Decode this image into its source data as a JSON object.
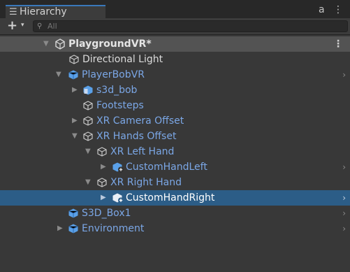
{
  "window": {
    "tab_icon": "hierarchy-list-icon",
    "tab_glyph": "☰",
    "tab_title": "Hierarchy",
    "lock_glyph": "a",
    "menu_glyph": "⋮"
  },
  "toolbar": {
    "add_label": "+",
    "add_caret": "▾",
    "search_placeholder": "All",
    "search_glyph": "⚲"
  },
  "tree": {
    "scene": {
      "label": "PlaygroundVR*",
      "menu": "⋮"
    },
    "rows": [
      {
        "label": "Directional Light",
        "icon": "gameobject-icon",
        "style": "white",
        "expanded": null
      },
      {
        "label": "PlayerBobVR",
        "icon": "prefab-icon",
        "style": "blue",
        "expanded": true,
        "chevron": "›"
      },
      {
        "label": "s3d_bob",
        "icon": "model-prefab-icon",
        "style": "blue",
        "expanded": false
      },
      {
        "label": "Footsteps",
        "icon": "gameobject-icon",
        "style": "blue",
        "expanded": null
      },
      {
        "label": "XR Camera Offset",
        "icon": "gameobject-icon",
        "style": "blue",
        "expanded": false
      },
      {
        "label": "XR Hands Offset",
        "icon": "gameobject-icon",
        "style": "blue",
        "expanded": true
      },
      {
        "label": "XR Left Hand",
        "icon": "gameobject-icon",
        "style": "blue",
        "expanded": true
      },
      {
        "label": "CustomHandLeft",
        "icon": "added-prefab-icon",
        "style": "blue",
        "expanded": false,
        "chevron": "›"
      },
      {
        "label": "XR Right Hand",
        "icon": "gameobject-icon",
        "style": "blue",
        "expanded": true
      },
      {
        "label": "CustomHandRight",
        "icon": "added-prefab-icon",
        "style": "sel",
        "expanded": false,
        "chevron": "›",
        "selected": true
      },
      {
        "label": "S3D_Box1",
        "icon": "prefab-icon",
        "style": "blue",
        "expanded": null,
        "chevron": "›"
      },
      {
        "label": "Environment",
        "icon": "prefab-icon",
        "style": "blue",
        "expanded": false,
        "chevron": "›"
      }
    ]
  },
  "colors": {
    "accent": "#3a79bb",
    "selection": "#2c5d87",
    "prefab_blue": "#7ba7e6",
    "panel": "#383838"
  }
}
